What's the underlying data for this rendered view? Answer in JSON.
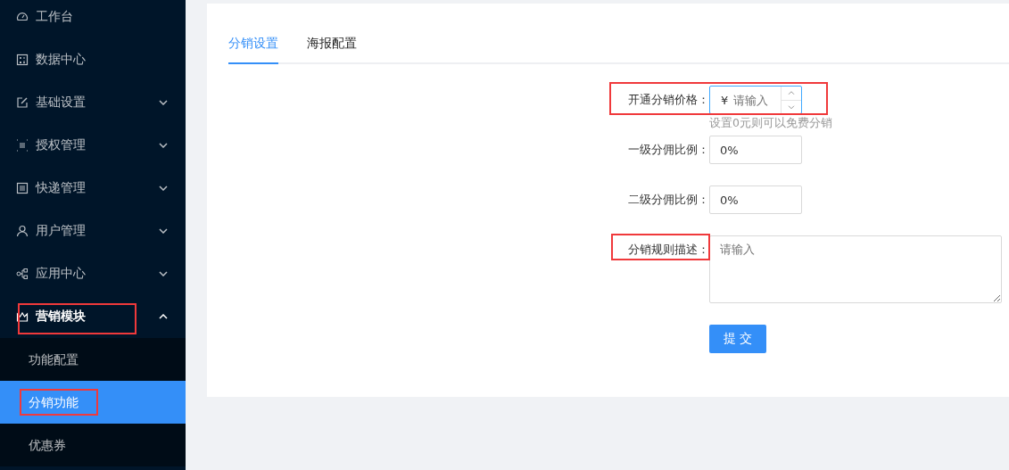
{
  "sidebar": {
    "items": [
      {
        "label": "工作台",
        "kind": "link",
        "highlighted": false
      },
      {
        "label": "数据中心",
        "kind": "link",
        "highlighted": false
      },
      {
        "label": "基础设置",
        "kind": "submenu",
        "expanded": false,
        "highlighted": false
      },
      {
        "label": "授权管理",
        "kind": "submenu",
        "expanded": false,
        "highlighted": false
      },
      {
        "label": "快递管理",
        "kind": "submenu",
        "expanded": false,
        "highlighted": false
      },
      {
        "label": "用户管理",
        "kind": "submenu",
        "expanded": false,
        "highlighted": false
      },
      {
        "label": "应用中心",
        "kind": "submenu",
        "expanded": false,
        "highlighted": false
      },
      {
        "label": "营销模块",
        "kind": "submenu",
        "expanded": true,
        "highlighted": true,
        "children": [
          {
            "label": "功能配置",
            "selected": false,
            "highlighted": false
          },
          {
            "label": "分销功能",
            "selected": true,
            "highlighted": true
          },
          {
            "label": "优惠券",
            "selected": false,
            "highlighted": false
          }
        ]
      }
    ]
  },
  "tabs": [
    {
      "label": "分销设置",
      "selected": true
    },
    {
      "label": "海报配置",
      "selected": false
    }
  ],
  "form": {
    "fields": [
      {
        "kind": "price",
        "label": "开通分销价格：",
        "prefix": "¥",
        "placeholder": "请输入",
        "hint": "设置0元则可以免费分销",
        "highlighted": true,
        "focused": true
      },
      {
        "kind": "text",
        "label": "一级分佣比例：",
        "value": "0%",
        "highlighted": false,
        "focused": false
      },
      {
        "kind": "text",
        "label": "二级分佣比例：",
        "value": "0%",
        "highlighted": false,
        "focused": false
      },
      {
        "kind": "textarea",
        "label": "分销规则描述：",
        "placeholder": "请输入",
        "highlighted": true,
        "focused": false
      }
    ],
    "submit": "提 交"
  }
}
